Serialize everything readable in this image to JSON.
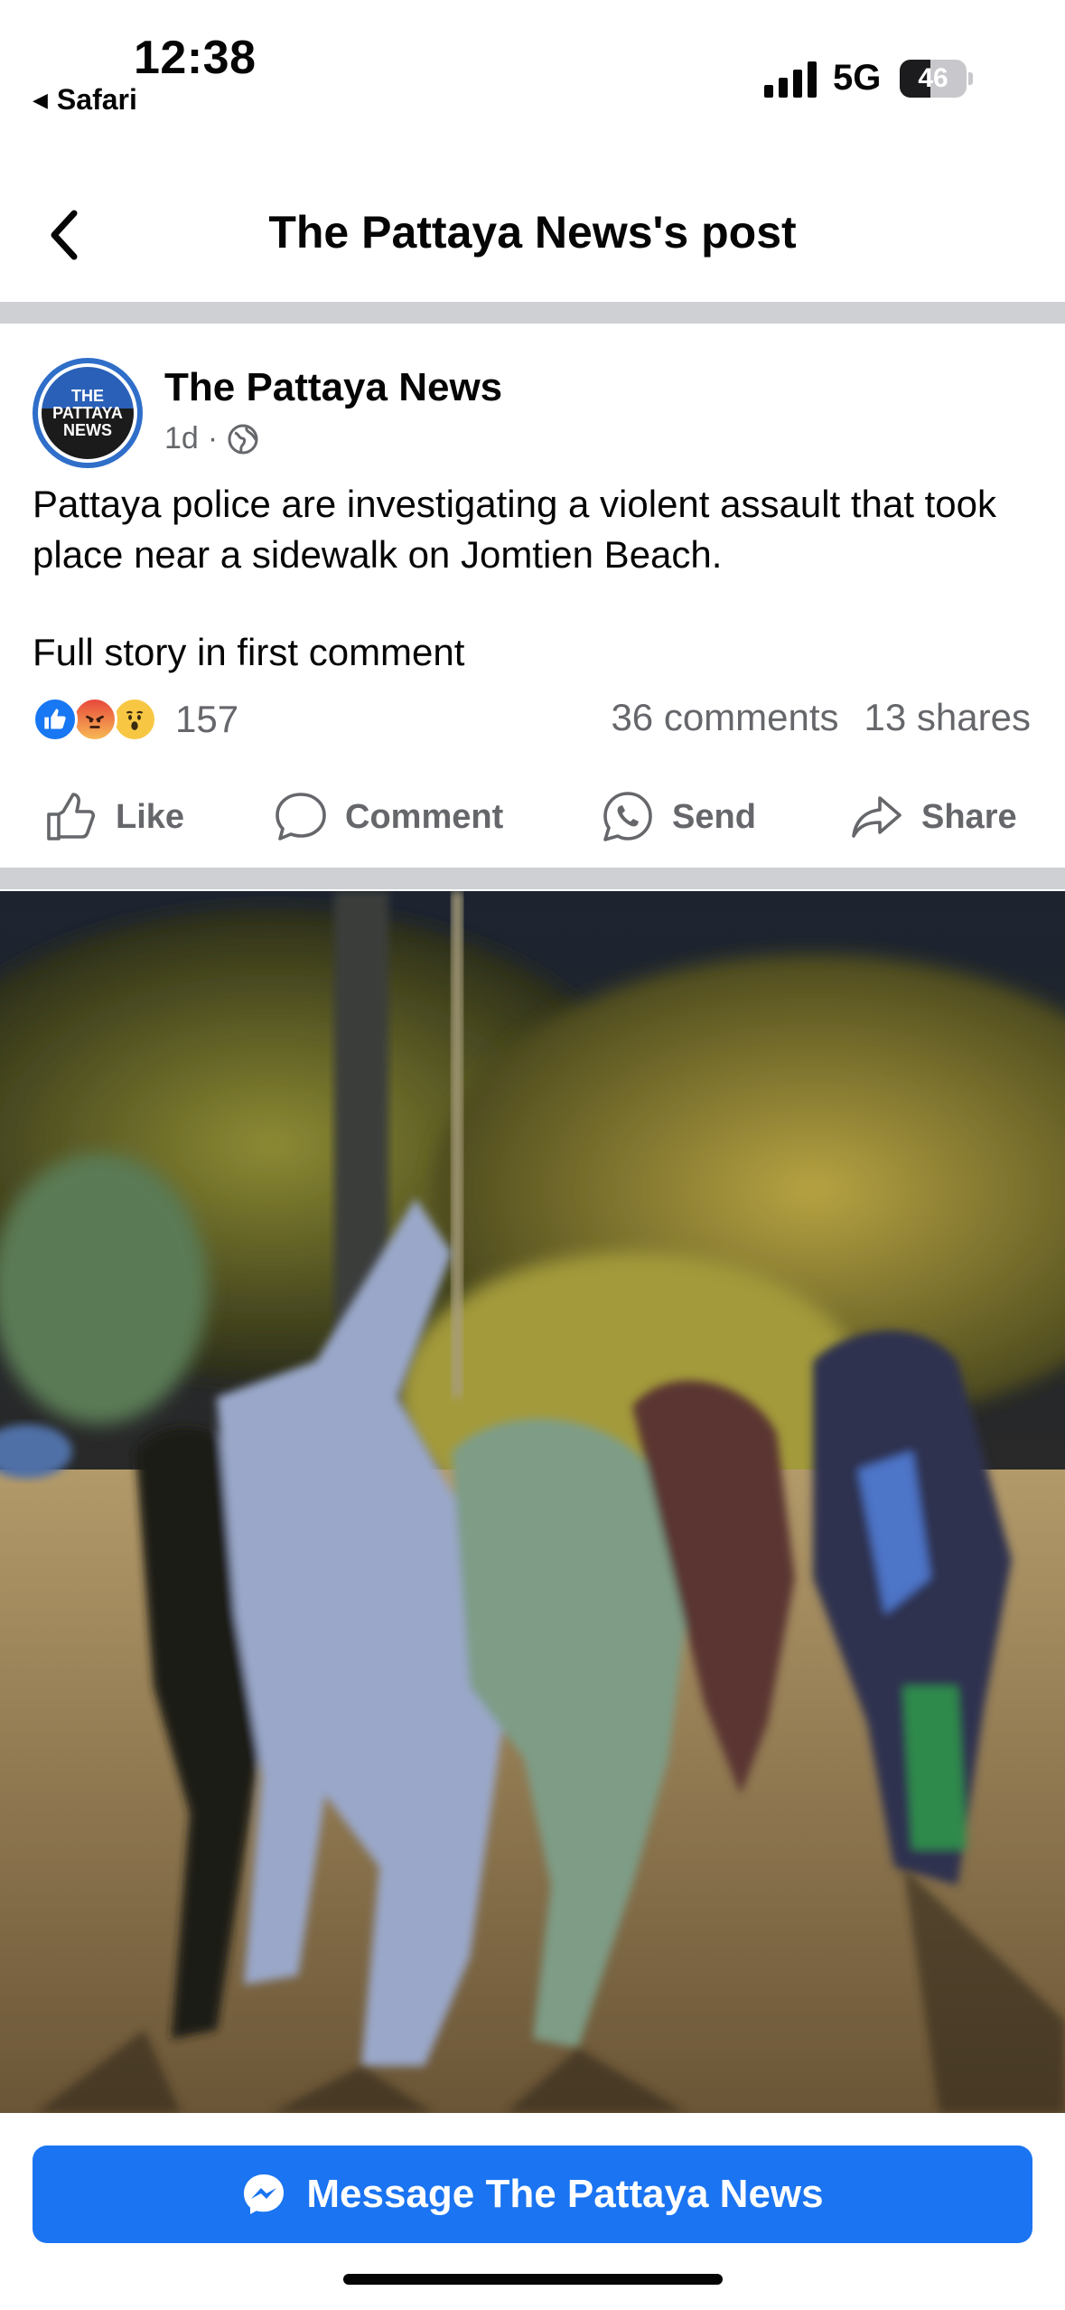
{
  "status_bar": {
    "time": "12:38",
    "back_app": "Safari",
    "network": "5G",
    "battery_level": "46",
    "battery_fraction": 0.46
  },
  "header": {
    "title": "The Pattaya News's post",
    "back_icon": "chevron-left-icon"
  },
  "post": {
    "avatar_text": [
      "THE",
      "PATTAYA",
      "NEWS"
    ],
    "page_name": "The Pattaya News",
    "age": "1d",
    "separator": "·",
    "audience_icon": "globe-icon",
    "text": [
      "Pattaya police are investigating a violent assault that took place near a sidewalk on Jomtien Beach.",
      "Full story in first comment"
    ],
    "reactions": {
      "icons": [
        "like-reaction-icon",
        "angry-reaction-icon",
        "wow-reaction-icon"
      ],
      "count": "157"
    },
    "comments": "36 comments",
    "shares": "13 shares"
  },
  "actions": [
    {
      "label": "Like",
      "icon": "thumbs-up-icon"
    },
    {
      "label": "Comment",
      "icon": "comment-bubble-icon"
    },
    {
      "label": "Send",
      "icon": "whatsapp-icon"
    },
    {
      "label": "Share",
      "icon": "share-arrow-icon"
    }
  ],
  "message_button": {
    "label": "Message The Pattaya News",
    "icon": "messenger-icon"
  },
  "colors": {
    "accent": "#1b74f1",
    "secondary_text": "#65676b",
    "divider": "#ced0d4"
  }
}
